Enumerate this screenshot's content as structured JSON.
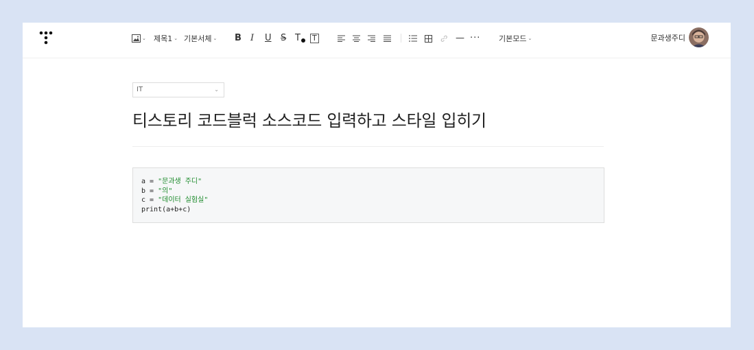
{
  "toolbar": {
    "heading_label": "제목1",
    "font_label": "기본서체",
    "mode_label": "기본모드",
    "bold": "B",
    "italic": "I",
    "underline": "U",
    "strike": "S",
    "text_color": "T",
    "text_bg": "T",
    "more": "···",
    "divider": "—"
  },
  "user": {
    "name": "문과생주디"
  },
  "editor": {
    "category": "IT",
    "title": "티스토리 코드블럭 소스코드 입력하고 스타일 입히기",
    "code_lines": [
      {
        "pre": "a = ",
        "str": "\"문과생 주디\""
      },
      {
        "pre": "b = ",
        "str": "\"의\""
      },
      {
        "pre": "c = ",
        "str": "\"데이터 실험실\""
      },
      {
        "pre": "print(a+b+c)",
        "str": ""
      }
    ]
  },
  "colors": {
    "background": "#d9e3f4",
    "string": "#1d8b2c",
    "code_bg": "#f6f7f8"
  }
}
